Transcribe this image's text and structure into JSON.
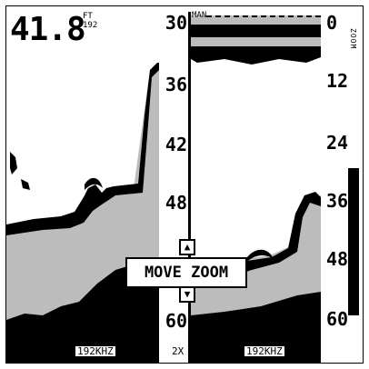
{
  "header": {
    "depth_value": "41.8",
    "depth_unit": "FT",
    "frequency_small": "192"
  },
  "left_scale": [
    "30",
    "36",
    "42",
    "48",
    "60"
  ],
  "right_scale": [
    "0",
    "12",
    "24",
    "36",
    "48",
    "60"
  ],
  "right_panel": {
    "mode_label": "MAN",
    "zoom_label": "ZOOM"
  },
  "popup": {
    "label": "MOVE ZOOM",
    "up_arrow": "▲",
    "down_arrow": "▼"
  },
  "footer": {
    "left_frequency": "192KHZ",
    "zoom_factor": "2X",
    "right_frequency": "192KHZ"
  },
  "icons": {
    "up": "arrow-up-icon",
    "down": "arrow-down-icon"
  }
}
